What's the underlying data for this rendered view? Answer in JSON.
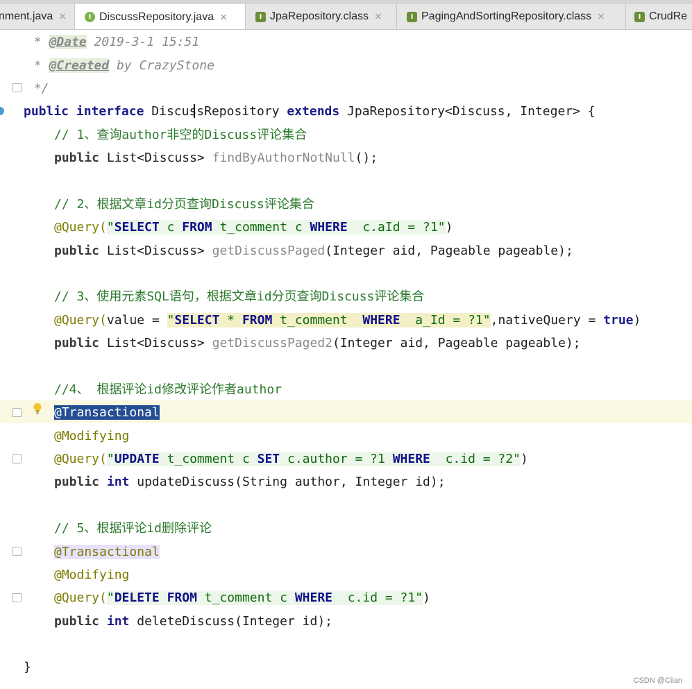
{
  "tabs": [
    {
      "label": "nment.java",
      "icon": "java-file-icon",
      "close": "×",
      "active": false
    },
    {
      "label": "DiscussRepository.java",
      "icon": "interface-icon",
      "icon_glyph": "I",
      "close": "×",
      "active": true
    },
    {
      "label": "JpaRepository.class",
      "icon": "class-file-icon",
      "icon_glyph": "I",
      "close": "×",
      "active": false
    },
    {
      "label": "PagingAndSortingRepository.class",
      "icon": "class-file-icon",
      "icon_glyph": "I",
      "close": "×",
      "active": false
    },
    {
      "label": "CrudRe",
      "icon": "class-file-icon",
      "icon_glyph": "I",
      "close": "",
      "active": false
    }
  ],
  "code": {
    "l1": {
      "star": " * ",
      "tag": "@Date",
      "rest": " 2019-3-1 15:51"
    },
    "l2": {
      "star": " * ",
      "tag": "@Created",
      "rest": " by CrazyStone"
    },
    "l3": {
      "text": " */"
    },
    "l4": {
      "kw1": "public",
      "kw2": "interface",
      "name": "DiscussRepository",
      "kw3": "extends",
      "rest": "JpaRepository<Discuss, Integer> {"
    },
    "l5": {
      "comment": "// 1、查询author非空的Discuss评论集合"
    },
    "l6": {
      "kw": "public",
      "type": "List<Discuss>",
      "method": "findByAuthorNotNull",
      "rest": "();"
    },
    "l8": {
      "comment": "// 2、根据文章id分页查询Discuss评论集合"
    },
    "l9": {
      "ann": "@Query(",
      "q": "\"",
      "s1": "SELECT",
      "t1": " c ",
      "s2": "FROM",
      "t2": " t_comment c ",
      "s3": "WHERE",
      "t3": "  c.aId = ?1",
      "q2": "\"",
      "end": ")"
    },
    "l10": {
      "kw": "public",
      "type": "List<Discuss>",
      "method": "getDiscussPaged",
      "rest": "(Integer aid, Pageable pageable);"
    },
    "l12": {
      "comment": "// 3、使用元素SQL语句，根据文章id分页查询Discuss评论集合"
    },
    "l13": {
      "ann": "@Query(",
      "pre": "value = ",
      "q": "\"",
      "s1": "SELECT",
      "t1": " * ",
      "s2": "FROM",
      "t2": " t_comment  ",
      "s3": "WHERE",
      "t3": "  a_Id = ?1",
      "q2": "\"",
      "mid": ",nativeQuery = ",
      "bool": "true",
      "end": ")"
    },
    "l14": {
      "kw": "public",
      "type": "List<Discuss>",
      "method": "getDiscussPaged2",
      "rest": "(Integer aid, Pageable pageable);"
    },
    "l16": {
      "comment": "//4、 根据评论id修改评论作者author"
    },
    "l17": {
      "ann": "@Transactional"
    },
    "l18": {
      "ann": "@Modifying"
    },
    "l19": {
      "ann": "@Query(",
      "q": "\"",
      "s1": "UPDATE",
      "t1": " t_comment c ",
      "s2": "SET",
      "t2": " c.author = ?1 ",
      "s3": "WHERE",
      "t3": "  c.id = ?2",
      "q2": "\"",
      "end": ")"
    },
    "l20": {
      "kw": "public",
      "type": "int",
      "method": "updateDiscuss",
      "rest": "(String author, Integer id);"
    },
    "l22": {
      "comment": "// 5、根据评论id删除评论"
    },
    "l23": {
      "ann": "@Transactional"
    },
    "l24": {
      "ann": "@Modifying"
    },
    "l25": {
      "ann": "@Query(",
      "q": "\"",
      "s1": "DELETE",
      "t1": " ",
      "s2": "FROM",
      "t2": " t_comment c ",
      "s3": "WHERE",
      "t3": "  c.id = ?1",
      "q2": "\"",
      "end": ")"
    },
    "l26": {
      "kw": "public",
      "type": "int",
      "method": "deleteDiscuss",
      "rest": "(Integer id);"
    },
    "l28": {
      "text": "}"
    }
  },
  "watermark": "CSDN @Ciian",
  "colors": {
    "keyword": "#1c1c8a",
    "comment": "#2c7a2c",
    "annotation": "#7c7c00",
    "selection": "#244f92",
    "caret_line": "#fbf8e2"
  }
}
